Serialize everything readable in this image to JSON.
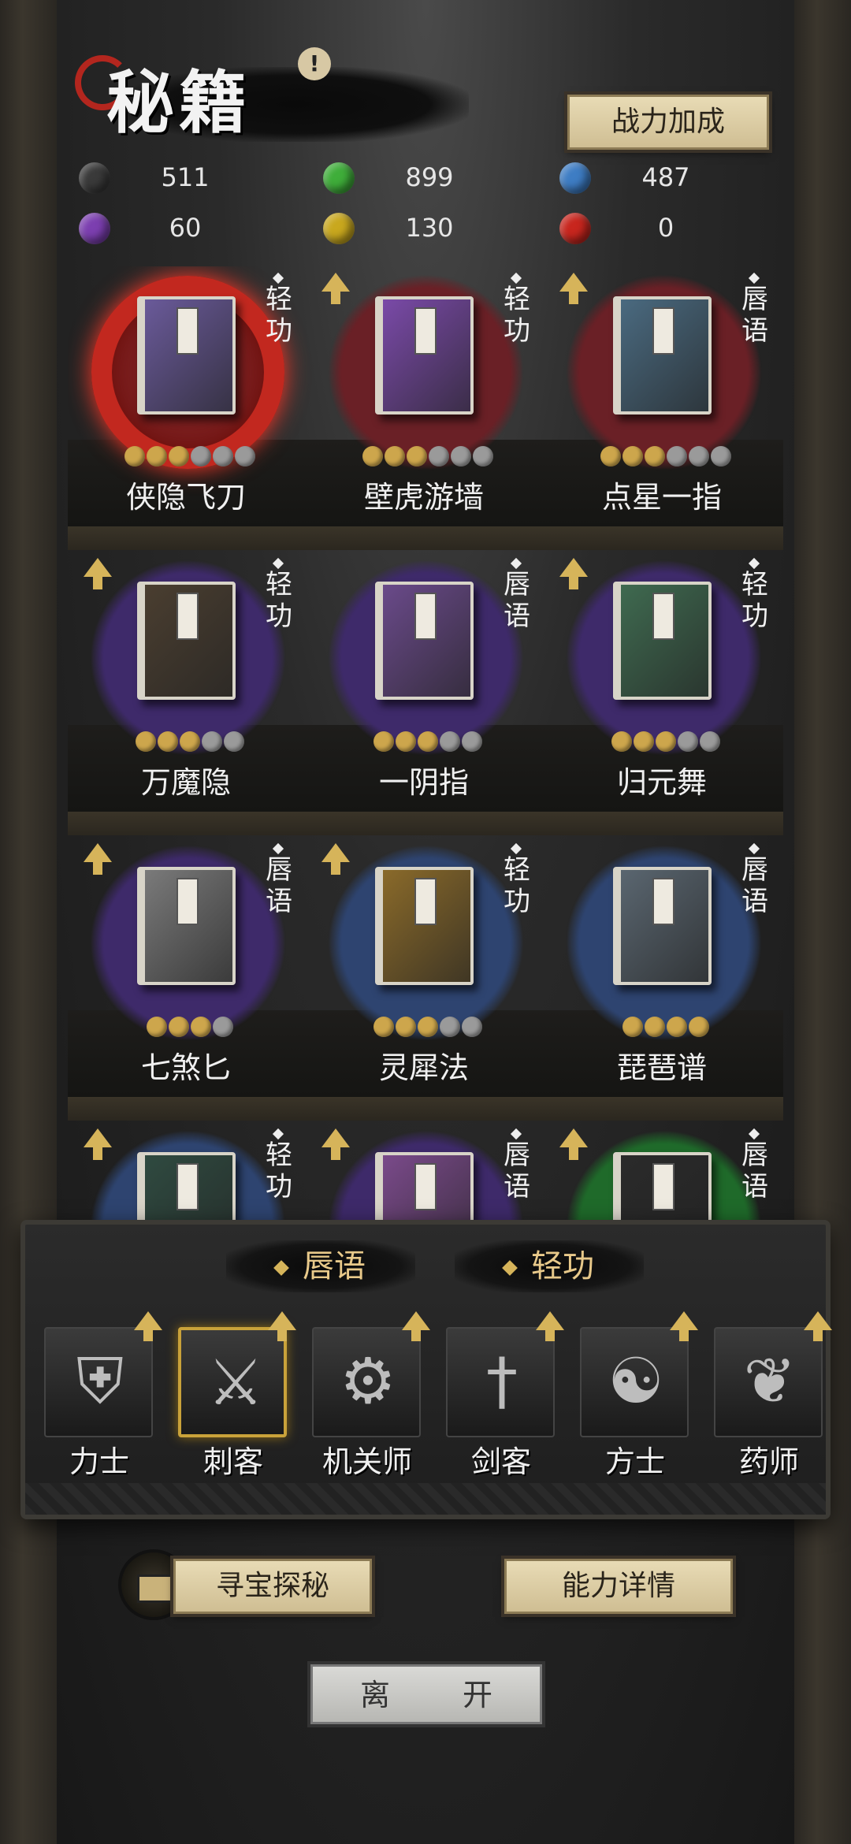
{
  "header": {
    "title": "秘籍",
    "power_button": "战力加成"
  },
  "resources": [
    {
      "orb": "black-orb",
      "color": "#3a3a3a",
      "value": "511"
    },
    {
      "orb": "green-orb",
      "color": "#3fae3a",
      "value": "899"
    },
    {
      "orb": "blue-orb",
      "color": "#3e7dc4",
      "value": "487"
    },
    {
      "orb": "purple-orb",
      "color": "#7c3fb0",
      "value": "60"
    },
    {
      "orb": "gold-orb",
      "color": "#c9a81e",
      "value": "130"
    },
    {
      "orb": "red-orb",
      "color": "#c8261e",
      "value": "0"
    }
  ],
  "books": [
    {
      "name": "侠隐飞刀",
      "tag": "轻功",
      "stars": 3,
      "max": 6,
      "halo": "#7a1e1e",
      "cover": "#6a5a9a",
      "upgrade": false,
      "selected": true
    },
    {
      "name": "壁虎游墙",
      "tag": "轻功",
      "stars": 3,
      "max": 6,
      "halo": "#6a2026",
      "cover": "#7a4aa8",
      "upgrade": true,
      "selected": false
    },
    {
      "name": "点星一指",
      "tag": "唇语",
      "stars": 3,
      "max": 6,
      "halo": "#6a2026",
      "cover": "#4a6a80",
      "upgrade": true,
      "selected": false
    },
    {
      "name": "万魔隐",
      "tag": "轻功",
      "stars": 3,
      "max": 5,
      "halo": "#3e2a6a",
      "cover": "#4a3e30",
      "upgrade": true,
      "selected": false
    },
    {
      "name": "一阴指",
      "tag": "唇语",
      "stars": 3,
      "max": 5,
      "halo": "#3e2a6a",
      "cover": "#6a4a8a",
      "upgrade": false,
      "selected": false
    },
    {
      "name": "归元舞",
      "tag": "轻功",
      "stars": 3,
      "max": 5,
      "halo": "#3e2a6a",
      "cover": "#3f6a50",
      "upgrade": true,
      "selected": false
    },
    {
      "name": "七煞匕",
      "tag": "唇语",
      "stars": 3,
      "max": 4,
      "halo": "#3e2a6a",
      "cover": "#7a7a7a",
      "upgrade": true,
      "selected": false
    },
    {
      "name": "灵犀法",
      "tag": "轻功",
      "stars": 3,
      "max": 5,
      "halo": "#2e4470",
      "cover": "#8a6a2a",
      "upgrade": true,
      "selected": false
    },
    {
      "name": "琵琶谱",
      "tag": "唇语",
      "stars": 4,
      "max": 4,
      "halo": "#2e4470",
      "cover": "#5a6670",
      "upgrade": false,
      "selected": false
    },
    {
      "name": "",
      "tag": "轻功",
      "stars": 0,
      "max": 0,
      "halo": "#2e4470",
      "cover": "#2f4a40",
      "upgrade": true,
      "selected": false
    },
    {
      "name": "",
      "tag": "唇语",
      "stars": 0,
      "max": 0,
      "halo": "#3e2a6a",
      "cover": "#7a4a8a",
      "upgrade": true,
      "selected": false
    },
    {
      "name": "",
      "tag": "唇语",
      "stars": 0,
      "max": 0,
      "halo": "#1f6a2a",
      "cover": "#2a2a2a",
      "upgrade": true,
      "selected": false
    }
  ],
  "filters": [
    "唇语",
    "轻功"
  ],
  "classes": [
    {
      "label": "力士",
      "icon": "shield-icon",
      "glyph": "⛨",
      "selected": false
    },
    {
      "label": "刺客",
      "icon": "blades-icon",
      "glyph": "⚔",
      "selected": true
    },
    {
      "label": "机关师",
      "icon": "gears-icon",
      "glyph": "⚙",
      "selected": false
    },
    {
      "label": "剑客",
      "icon": "sword-icon",
      "glyph": "†",
      "selected": false
    },
    {
      "label": "方士",
      "icon": "yin-yang-icon",
      "glyph": "☯",
      "selected": false
    },
    {
      "label": "药师",
      "icon": "herb-icon",
      "glyph": "❦",
      "selected": false
    }
  ],
  "buttons": {
    "treasure": "寻宝探秘",
    "ability": "能力详情",
    "leave": "离 开"
  }
}
